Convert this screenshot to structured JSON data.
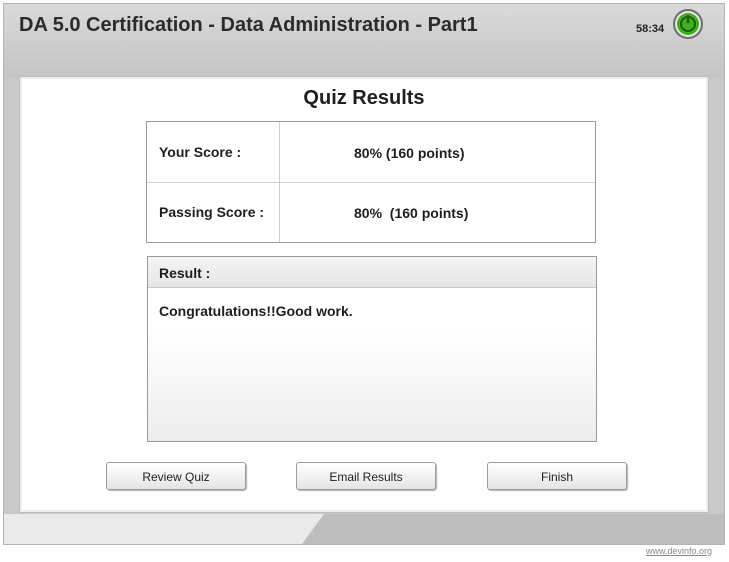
{
  "header": {
    "course_title": "DA 5.0 Certification - Data Administration - Part1",
    "timer": "58:34",
    "timer_icon": "power-clock-icon",
    "timer_color": "#3fae1f"
  },
  "results": {
    "heading": "Quiz Results",
    "rows": [
      {
        "label": "Your Score :",
        "value": "80% (160 points)"
      },
      {
        "label": "Passing Score :",
        "value": "80%  (160 points)"
      }
    ],
    "result_label": "Result :",
    "result_message": "Congratulations!!Good work."
  },
  "buttons": {
    "review": "Review Quiz",
    "email": "Email Results",
    "finish": "Finish"
  },
  "footer": {
    "site_link": "www.devinfo.org"
  }
}
